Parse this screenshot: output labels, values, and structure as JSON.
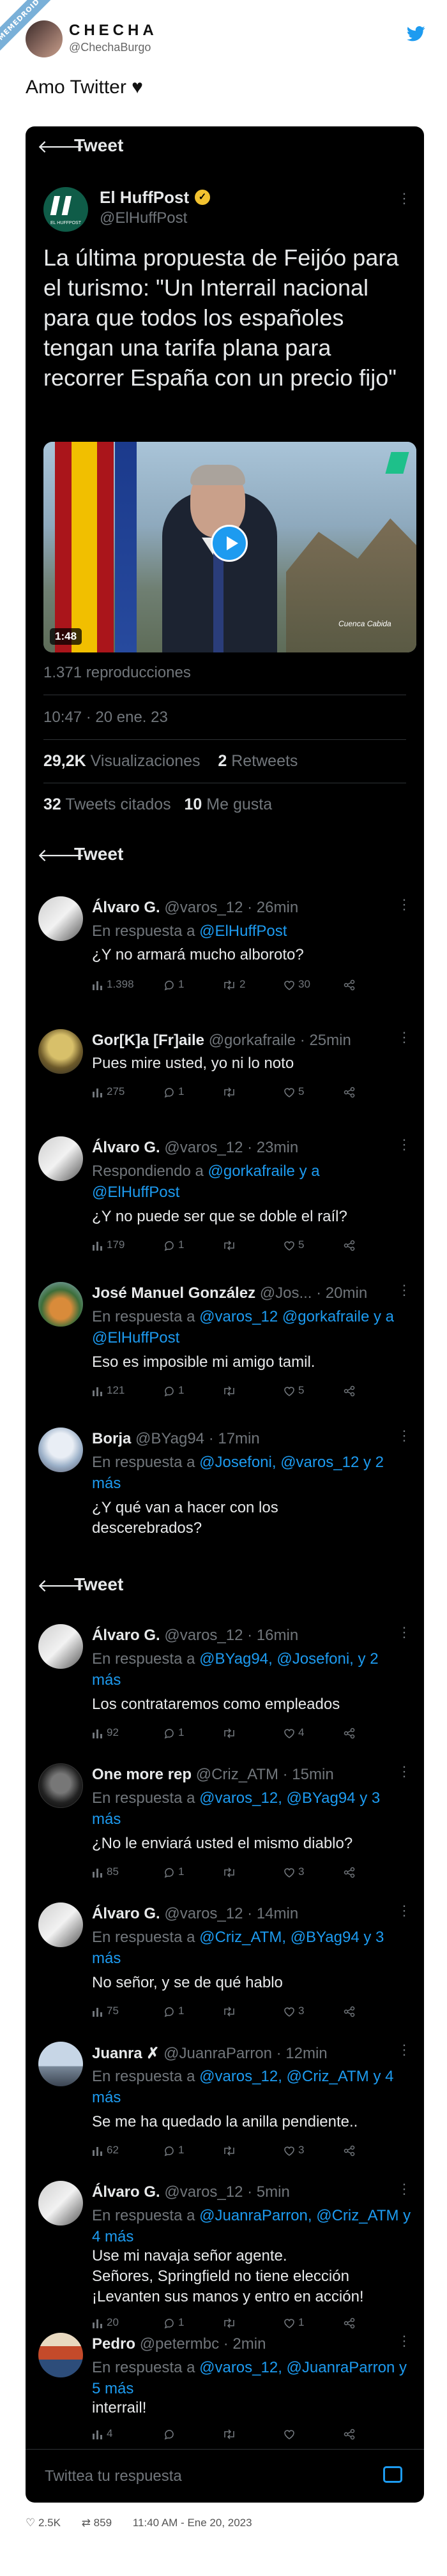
{
  "badge": "MEMEDROID",
  "header": {
    "name": "CHECHA",
    "handle": "@ChechaBurgo"
  },
  "caption": "Amo Twitter ♥",
  "tweet": {
    "bar_title": "Tweet",
    "author_name": "El HuffPost",
    "author_handle": "@ElHuffPost",
    "logo_text": "EL HUFFPOST",
    "text": "La última propuesta de Feijóo para el turismo: \"Un Interrail nacional para que todos los españoles tengan una tarifa plana para recorrer España con un precio fijo\"",
    "video_duration": "1:48",
    "video_caption": "Cuenca Cabida",
    "views_line": "1.371 reproducciones",
    "datetime": "10:47 · 20 ene. 23",
    "visualizaciones_count": "29,2K",
    "visualizaciones_label": "Visualizaciones",
    "retweets_count": "2",
    "retweets_label": "Retweets",
    "quotes_count": "32",
    "quotes_label": "Tweets citados",
    "likes_count": "10",
    "likes_label": "Me gusta"
  },
  "replies": [
    {
      "name": "Álvaro G.",
      "handle": "@varos_12",
      "time": "· 26min",
      "prefix": "En respuesta a",
      "mentions": " @ElHuffPost",
      "text": "¿Y no armará mucho alboroto?",
      "views": "1.398",
      "replies": "1",
      "retweets": "2",
      "likes": "30"
    },
    {
      "name": "Gor[K]a [Fr]aile",
      "handle": "@gorkafraile",
      "time": "· 25min",
      "prefix": "",
      "mentions": "",
      "text": "Pues mire usted, yo ni lo noto",
      "views": "275",
      "replies": "1",
      "retweets": "",
      "likes": "5"
    },
    {
      "name": "Álvaro G.",
      "handle": "@varos_12",
      "time": "· 23min",
      "prefix": "Respondiendo a",
      "mentions": " @gorkafraile y a @ElHuffPost",
      "text": "¿Y no puede ser que se doble el raíl?",
      "views": "179",
      "replies": "1",
      "retweets": "",
      "likes": "5"
    },
    {
      "name": "José Manuel González",
      "handle": "@Jos...",
      "time": "· 20min",
      "prefix": "En respuesta a",
      "mentions": " @varos_12 @gorkafraile y a @ElHuffPost",
      "text": "Eso es imposible mi amigo tamil.",
      "views": "121",
      "replies": "1",
      "retweets": "",
      "likes": "5"
    },
    {
      "name": "Borja",
      "handle": "@BYag94",
      "time": "· 17min",
      "prefix": "En respuesta a",
      "mentions": " @Josefoni, @varos_12 y 2 más",
      "text": "¿Y qué van a hacer con los\ndescerebrados?",
      "views": "",
      "replies": "",
      "retweets": "",
      "likes": ""
    },
    {
      "name": "Álvaro G.",
      "handle": "@varos_12",
      "time": "· 16min",
      "prefix": "En respuesta a",
      "mentions": " @BYag94, @Josefoni, y 2 más",
      "text": "Los contrataremos como empleados",
      "views": "92",
      "replies": "1",
      "retweets": "",
      "likes": "4"
    },
    {
      "name": "One more rep",
      "handle": "@Criz_ATM",
      "time": "· 15min",
      "prefix": "En respuesta a",
      "mentions": " @varos_12, @BYag94 y 3 más",
      "text": "¿No le enviará usted el mismo diablo?",
      "views": "85",
      "replies": "1",
      "retweets": "",
      "likes": "3"
    },
    {
      "name": "Álvaro G.",
      "handle": "@varos_12",
      "time": "· 14min",
      "prefix": "En respuesta a",
      "mentions": " @Criz_ATM, @BYag94 y 3 más",
      "text": "No señor, y se de qué hablo",
      "views": "75",
      "replies": "1",
      "retweets": "",
      "likes": "3"
    },
    {
      "name": "Juanra ✗",
      "handle": "@JuanraParron",
      "time": "· 12min",
      "prefix": "En respuesta a",
      "mentions": " @varos_12, @Criz_ATM y 4 más",
      "text": "Se me ha quedado la anilla pendiente..",
      "views": "62",
      "replies": "1",
      "retweets": "",
      "likes": "3"
    },
    {
      "name": "Álvaro G.",
      "handle": "@varos_12",
      "time": "· 5min",
      "prefix": "En respuesta a",
      "mentions": " @JuanraParron, @Criz_ATM y 4 más",
      "text": "Use mi navaja señor agente.\nSeñores, Springfield no tiene elección\n¡Levanten sus manos y entro en acción!",
      "views": "20",
      "replies": "1",
      "retweets": "",
      "likes": "1"
    },
    {
      "name": "Pedro",
      "handle": "@petermbc",
      "time": "· 2min",
      "prefix": "En respuesta a",
      "mentions": " @varos_12, @JuanraParron y 5 más",
      "text": "interrail!",
      "views": "4",
      "replies": "",
      "retweets": "",
      "likes": ""
    }
  ],
  "compose_placeholder": "Twittea tu respuesta",
  "footer": {
    "likes": "2.5K",
    "retweets": "859",
    "time": "11:40 AM - Ene 20, 2023"
  },
  "colors": {
    "accent": "#1d9bf0",
    "dark_bg": "#000000",
    "muted": "#71767b"
  }
}
